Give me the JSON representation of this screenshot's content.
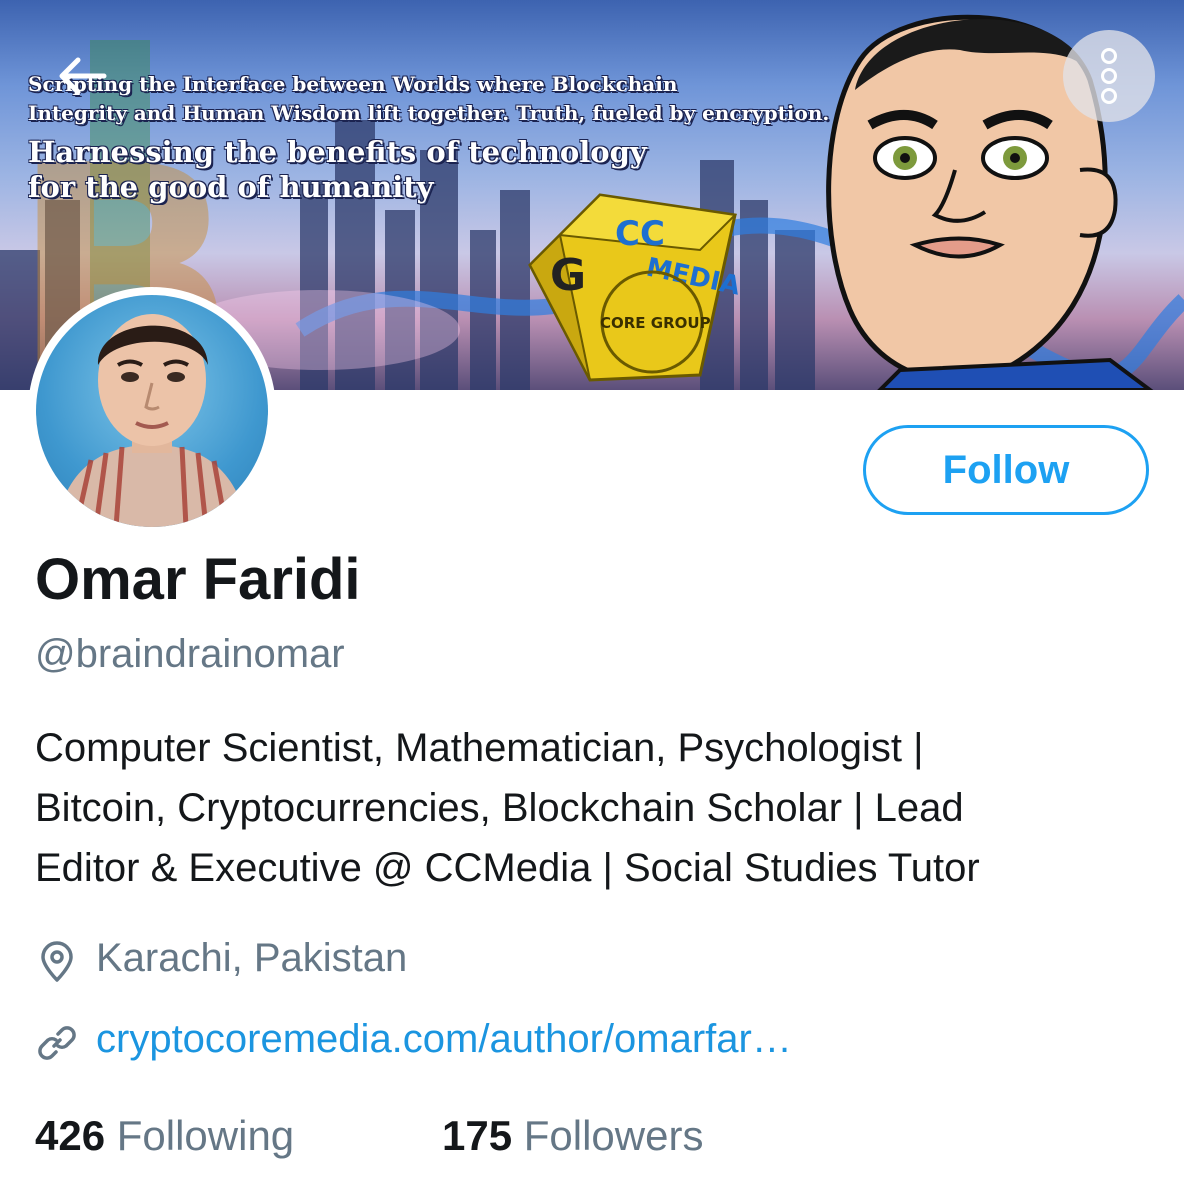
{
  "banner": {
    "line1": "Scripting the Interface between Worlds where Blockchain",
    "line2": "Integrity and Human Wisdom lift together. Truth, fueled by encryption.",
    "line3": "Harnessing the benefits of technology",
    "line4": "for the good of humanity",
    "cube_logo": "CC MEDIA",
    "seal_text": "CORE GROUP"
  },
  "nav": {
    "back_icon": "arrow-left-icon",
    "more_icon": "more-vertical-icon"
  },
  "profile": {
    "name": "Omar Faridi",
    "handle": "@braindrainomar",
    "bio_lines": [
      "Computer Scientist, Mathematician, Psychologist |",
      "Bitcoin, Cryptocurrencies, Blockchain Scholar | Lead",
      "Editor & Executive @ CCMedia | Social Studies Tutor"
    ],
    "location": "Karachi, Pakistan",
    "location_icon": "location-pin-icon",
    "url": "cryptocoremedia.com/author/omarfar…",
    "url_icon": "link-icon"
  },
  "actions": {
    "follow_label": "Follow"
  },
  "stats": {
    "following_count": "426",
    "following_label": "Following",
    "followers_count": "175",
    "followers_label": "Followers"
  },
  "colors": {
    "accent": "#1da1f2",
    "link": "#1b95e0",
    "secondary_text": "#657786",
    "primary_text": "#14171a"
  }
}
